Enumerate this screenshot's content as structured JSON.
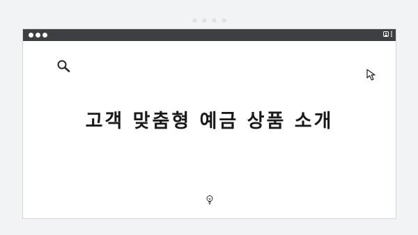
{
  "window": {
    "title_bar_color": "#3d3f42"
  },
  "icons": {
    "search": "search-icon",
    "cursor": "cursor-arrow-icon",
    "bulb": "lightbulb-icon",
    "user": "user-icon",
    "menu": "kebab-menu-icon"
  },
  "content": {
    "headline": "고객 맞춤형 예금 상품 소개"
  }
}
